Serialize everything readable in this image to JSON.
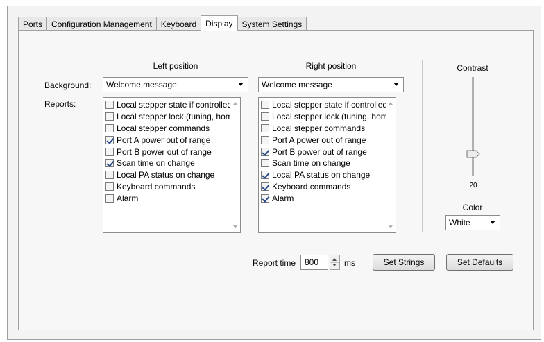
{
  "tabs": [
    {
      "label": "Ports",
      "active": false
    },
    {
      "label": "Configuration Management",
      "active": false
    },
    {
      "label": "Keyboard",
      "active": false
    },
    {
      "label": "Display",
      "active": true
    },
    {
      "label": "System Settings",
      "active": false
    }
  ],
  "display": {
    "left_heading": "Left position",
    "right_heading": "Right position",
    "background_label": "Background:",
    "reports_label": "Reports:",
    "left_background": "Welcome message",
    "right_background": "Welcome message",
    "left_reports": [
      {
        "label": "Local stepper state if controlled",
        "checked": false
      },
      {
        "label": "Local stepper lock (tuning, home",
        "checked": false
      },
      {
        "label": "Local stepper commands",
        "checked": false
      },
      {
        "label": "Port A power out of range",
        "checked": true
      },
      {
        "label": "Port B power out of range",
        "checked": false
      },
      {
        "label": "Scan time on change",
        "checked": true
      },
      {
        "label": "Local PA status on change",
        "checked": false
      },
      {
        "label": "Keyboard commands",
        "checked": false
      },
      {
        "label": "Alarm",
        "checked": false
      }
    ],
    "right_reports": [
      {
        "label": "Local stepper state if controlled",
        "checked": false
      },
      {
        "label": "Local stepper lock (tuning, home",
        "checked": false
      },
      {
        "label": "Local stepper commands",
        "checked": false
      },
      {
        "label": "Port A power out of range",
        "checked": false
      },
      {
        "label": "Port B power out of range",
        "checked": true
      },
      {
        "label": "Scan time on change",
        "checked": false
      },
      {
        "label": "Local PA status on change",
        "checked": true
      },
      {
        "label": "Keyboard commands",
        "checked": true
      },
      {
        "label": "Alarm",
        "checked": true
      }
    ],
    "contrast_label": "Contrast",
    "contrast_value": "20",
    "color_label": "Color",
    "color_value": "White",
    "report_time_label": "Report time",
    "report_time_value": "800",
    "report_time_unit": "ms",
    "set_strings_label": "Set Strings",
    "set_defaults_label": "Set Defaults"
  }
}
